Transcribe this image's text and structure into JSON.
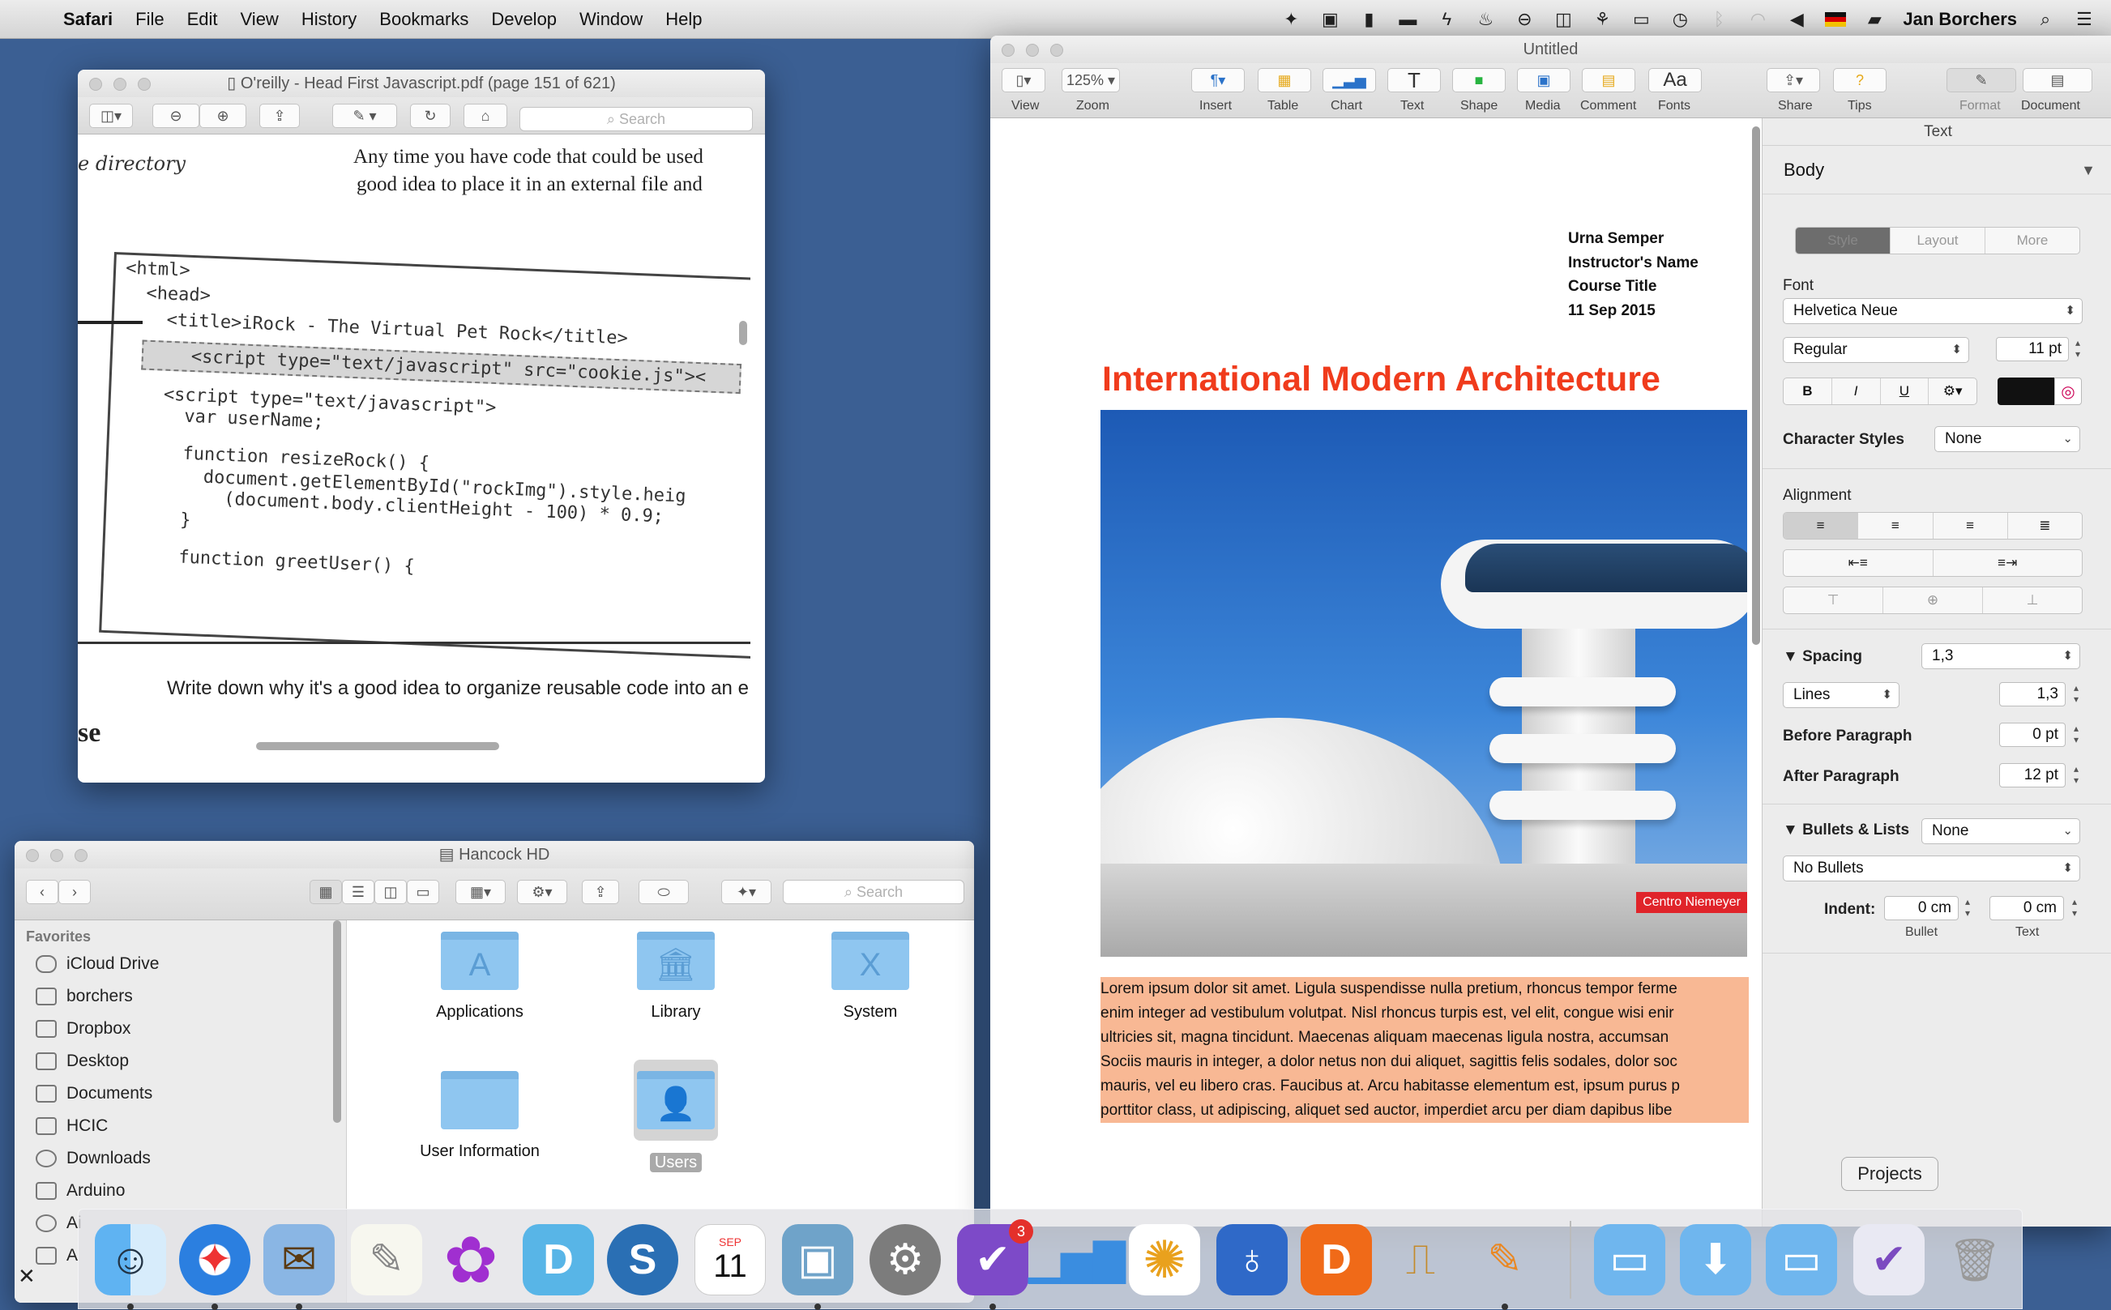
{
  "menubar": {
    "app": "Safari",
    "items": [
      "File",
      "Edit",
      "View",
      "History",
      "Bookmarks",
      "Develop",
      "Window",
      "Help"
    ],
    "user": "Jan Borchers"
  },
  "pdf_window": {
    "title": "O'reilly - Head First Javascript.pdf (page 151 of 621)",
    "search_placeholder": "Search",
    "handwriting_top": "e directory",
    "intro_line_1": "Any time you have code that could be used",
    "intro_line_2": "good idea to place it in an external file and",
    "code_lines": [
      "<html>",
      "  <head>",
      "    <title>iRock - The Virtual Pet Rock</title>",
      "    <script type=\"text/javascript\" src=\"cookie.js\"><",
      "    <script type=\"text/javascript\">",
      "      var userName;",
      "      function resizeRock() {",
      "        document.getElementById(\"rockImg\").style.heig",
      "          (document.body.clientHeight - 100) * 0.9;",
      "      }",
      "      function greetUser() {"
    ],
    "exercise_text": "Write down why it's a good idea to organize reusable code into an e",
    "margin_fragment": "se"
  },
  "finder": {
    "title": "Hancock HD",
    "search_placeholder": "Search",
    "sidebar_heading": "Favorites",
    "sidebar_items": [
      "iCloud Drive",
      "borchers",
      "Dropbox",
      "Desktop",
      "Documents",
      "HCIC",
      "Downloads",
      "Arduino",
      "Ai",
      "A"
    ],
    "folders": [
      {
        "label": "Applications",
        "glyph": "A"
      },
      {
        "label": "Library",
        "glyph": "🏛"
      },
      {
        "label": "System",
        "glyph": "X"
      },
      {
        "label": "User Information",
        "glyph": ""
      },
      {
        "label": "Users",
        "glyph": "👤"
      }
    ]
  },
  "pages": {
    "title": "Untitled",
    "zoom": "125%",
    "toolbar": {
      "view": "View",
      "zoom": "Zoom",
      "insert": "Insert",
      "table": "Table",
      "chart": "Chart",
      "text": "Text",
      "shape": "Shape",
      "media": "Media",
      "comment": "Comment",
      "fonts": "Fonts",
      "share": "Share",
      "tips": "Tips",
      "format": "Format",
      "document": "Document"
    },
    "doc": {
      "name": "Urna Semper",
      "instructor": "Instructor's Name",
      "course": "Course Title",
      "date": "11 Sep 2015",
      "title": "International Modern Architecture",
      "photo_tag": "Centro Niemeyer",
      "body_lines": [
        "Lorem ipsum dolor sit amet. Ligula suspendisse nulla pretium, rhoncus tempor ferme",
        "enim integer ad vestibulum volutpat. Nisl rhoncus turpis est, vel elit, congue wisi enir",
        "ultricies sit, magna tincidunt. Maecenas aliquam maecenas ligula nostra, accumsan",
        "Sociis mauris in integer, a dolor netus non dui aliquet, sagittis felis sodales, dolor soc",
        "mauris, vel eu libero cras. Faucibus at. Arcu habitasse elementum est, ipsum purus p",
        "porttitor class, ut adipiscing, aliquet sed auctor, imperdiet arcu per diam dapibus libe"
      ]
    },
    "inspector": {
      "tab": "Text",
      "paragraph_style": "Body",
      "segments": [
        "Style",
        "Layout",
        "More"
      ],
      "font_label": "Font",
      "font_family": "Helvetica Neue",
      "font_weight": "Regular",
      "font_size": "11 pt",
      "bold": "B",
      "italic": "I",
      "underline": "U",
      "char_styles_label": "Character Styles",
      "char_styles_value": "None",
      "alignment_label": "Alignment",
      "spacing_label": "Spacing",
      "spacing_value": "1,3",
      "lines_label": "Lines",
      "lines_value": "1,3",
      "before_label": "Before Paragraph",
      "before_value": "0 pt",
      "after_label": "After Paragraph",
      "after_value": "12 pt",
      "bullets_label": "Bullets & Lists",
      "bullets_value": "None",
      "bullets_style": "No Bullets",
      "indent_label": "Indent:",
      "indent_bullet": "0 cm",
      "indent_text": "0 cm",
      "bullet_caption": "Bullet",
      "text_caption": "Text"
    }
  },
  "dock": {
    "tooltip": "Projects",
    "calendar_month": "SEP",
    "calendar_day": "11",
    "reminders_badge": "3"
  },
  "colors": {
    "desktop": "#3b5f93",
    "doc_title": "#f03b1c",
    "body_highlight": "#f8b894"
  }
}
